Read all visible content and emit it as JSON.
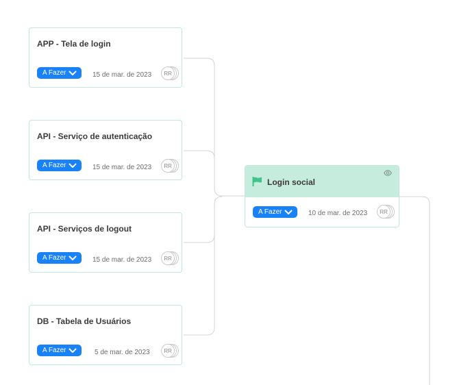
{
  "cards": [
    {
      "title": "APP - Tela de login",
      "status": "A Fazer",
      "date": "15 de mar. de 2023",
      "avatar": "RR"
    },
    {
      "title": "API - Serviço de autenticação",
      "status": "A Fazer",
      "date": "15 de mar. de 2023",
      "avatar": "RR"
    },
    {
      "title": "API - Serviços de logout",
      "status": "A Fazer",
      "date": "15 de mar. de 2023",
      "avatar": "RR"
    },
    {
      "title": "DB - Tabela de Usuários",
      "status": "A Fazer",
      "date": "5 de mar. de 2023",
      "avatar": "RR"
    }
  ],
  "main": {
    "title": "Login social",
    "status": "A Fazer",
    "date": "10 de mar. de 2023",
    "avatar": "RR"
  },
  "colors": {
    "accent": "#1a82f7",
    "card_border": "#bfe9dc",
    "header_fill": "#c5ecdc",
    "flag": "#3fc48c",
    "connector": "#cfd5d8"
  },
  "icons": {
    "status_chevron": "chevron-down-icon",
    "flag": "flag-icon",
    "watch": "eye-icon"
  }
}
